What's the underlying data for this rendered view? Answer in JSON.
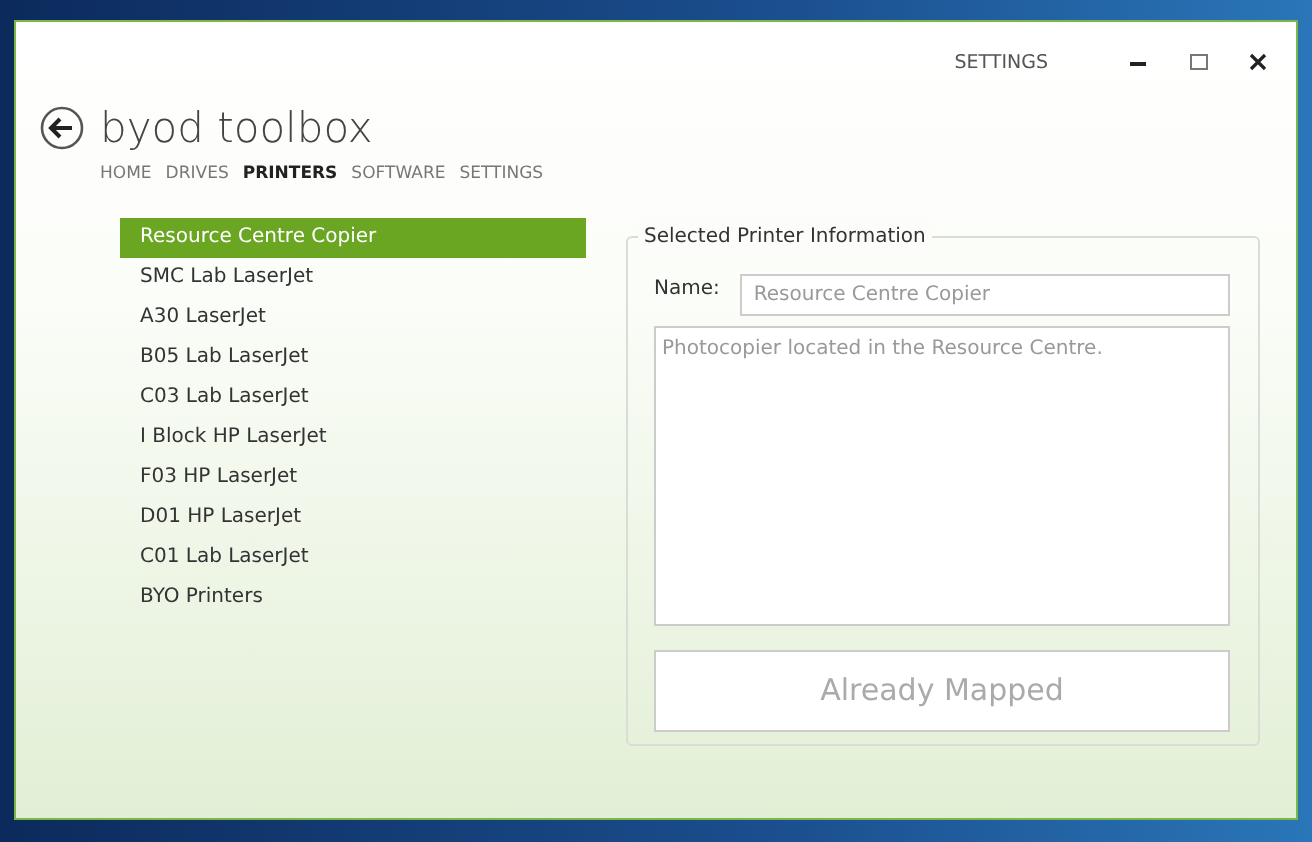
{
  "window": {
    "settings_link": "SETTINGS",
    "controls": [
      {
        "kind": "minimize"
      },
      {
        "kind": "maximize"
      },
      {
        "kind": "close"
      }
    ]
  },
  "app": {
    "title": "byod toolbox"
  },
  "tabs": [
    {
      "label": "HOME",
      "selected": false
    },
    {
      "label": "DRIVES",
      "selected": false
    },
    {
      "label": "PRINTERS",
      "selected": true
    },
    {
      "label": "SOFTWARE",
      "selected": false
    },
    {
      "label": "SETTINGS",
      "selected": false
    }
  ],
  "printers": [
    {
      "label": "Resource Centre Copier",
      "selected": true
    },
    {
      "label": "SMC Lab LaserJet",
      "selected": false
    },
    {
      "label": "A30 LaserJet",
      "selected": false
    },
    {
      "label": "B05 Lab LaserJet",
      "selected": false
    },
    {
      "label": "C03 Lab LaserJet",
      "selected": false
    },
    {
      "label": "I Block HP LaserJet",
      "selected": false
    },
    {
      "label": "F03 HP LaserJet",
      "selected": false
    },
    {
      "label": "D01 HP LaserJet",
      "selected": false
    },
    {
      "label": "C01 Lab LaserJet",
      "selected": false
    },
    {
      "label": "BYO Printers",
      "selected": false
    }
  ],
  "details": {
    "legend": "Selected Printer Information",
    "name_label": "Name:",
    "name_value": "Resource Centre Copier",
    "description": "Photocopier located in the Resource Centre.",
    "fields_disabled": true,
    "button": {
      "label": "Already Mapped",
      "disabled": true
    }
  }
}
